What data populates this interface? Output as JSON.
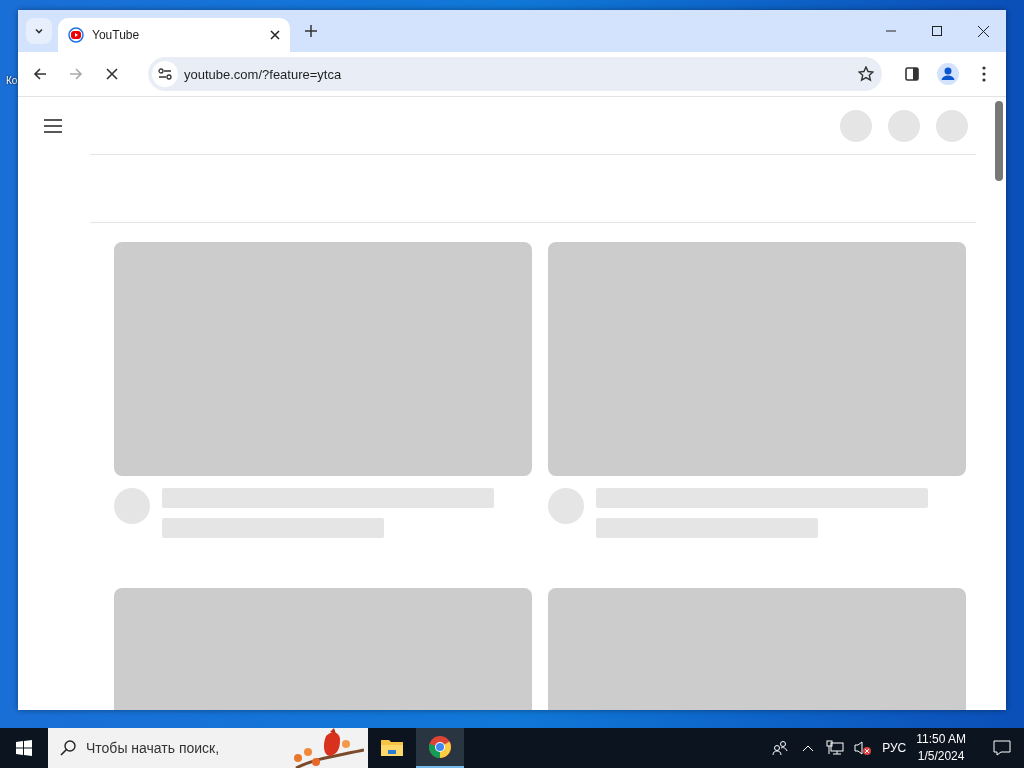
{
  "desktop": {
    "icon_label": "Ко"
  },
  "browser": {
    "tabs": [
      {
        "title": "YouTube",
        "selected": true
      }
    ],
    "address": "youtube.com/?feature=ytca",
    "loading": true
  },
  "taskbar": {
    "search": {
      "placeholder": "Чтобы начать поиск,"
    },
    "apps": [
      {
        "kind": "explorer",
        "selected": false
      },
      {
        "kind": "chrome",
        "selected": true
      }
    ],
    "language": "РУС",
    "time": "11:50 AM",
    "date": "1/5/2024"
  }
}
